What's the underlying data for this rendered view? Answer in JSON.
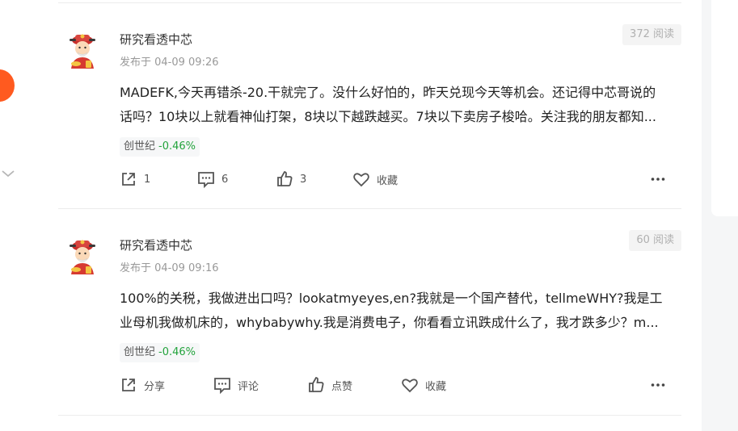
{
  "colors": {
    "accent_orange": "#ff5a1f",
    "change_green": "#23a33c",
    "background": "#f5f6f7"
  },
  "icons": {
    "share": "share-icon",
    "comment": "comment-icon",
    "like": "thumbs-up-icon",
    "favorite": "heart-icon",
    "more": "more-icon",
    "chevron": "chevron-down-icon",
    "avatar": "caishen-avatar-icon"
  },
  "posts": [
    {
      "author": "研究看透中芯",
      "time": "发布于 04-09 09:26",
      "reads": "372 阅读",
      "content_line1": "MADEFK,今天再错杀-20.干就完了。没什么好怕的，昨天兑现今天等机会。还记得中芯哥说的",
      "content_line2": "话吗？10块以上就看神仙打架，8块以下越跌越买。7块以下卖房子梭哈。关注我的朋友都知...",
      "stock": "创世纪",
      "change": "-0.46%",
      "share": "1",
      "comment": "6",
      "like": "3",
      "favorite": "收藏"
    },
    {
      "author": "研究看透中芯",
      "time": "发布于 04-09 09:16",
      "reads": "60 阅读",
      "content_line1": "100%的关税，我做进出口吗？lookatmyeyes,en?我就是一个国产替代，tellmeWHY?我是工",
      "content_line2": "业母机我做机床的，whybabywhy.我是消费电子，你看看立讯跌成什么了，我才跌多少？m...",
      "stock": "创世纪",
      "change": "-0.46%",
      "share": "分享",
      "comment": "评论",
      "like": "点赞",
      "favorite": "收藏"
    }
  ]
}
